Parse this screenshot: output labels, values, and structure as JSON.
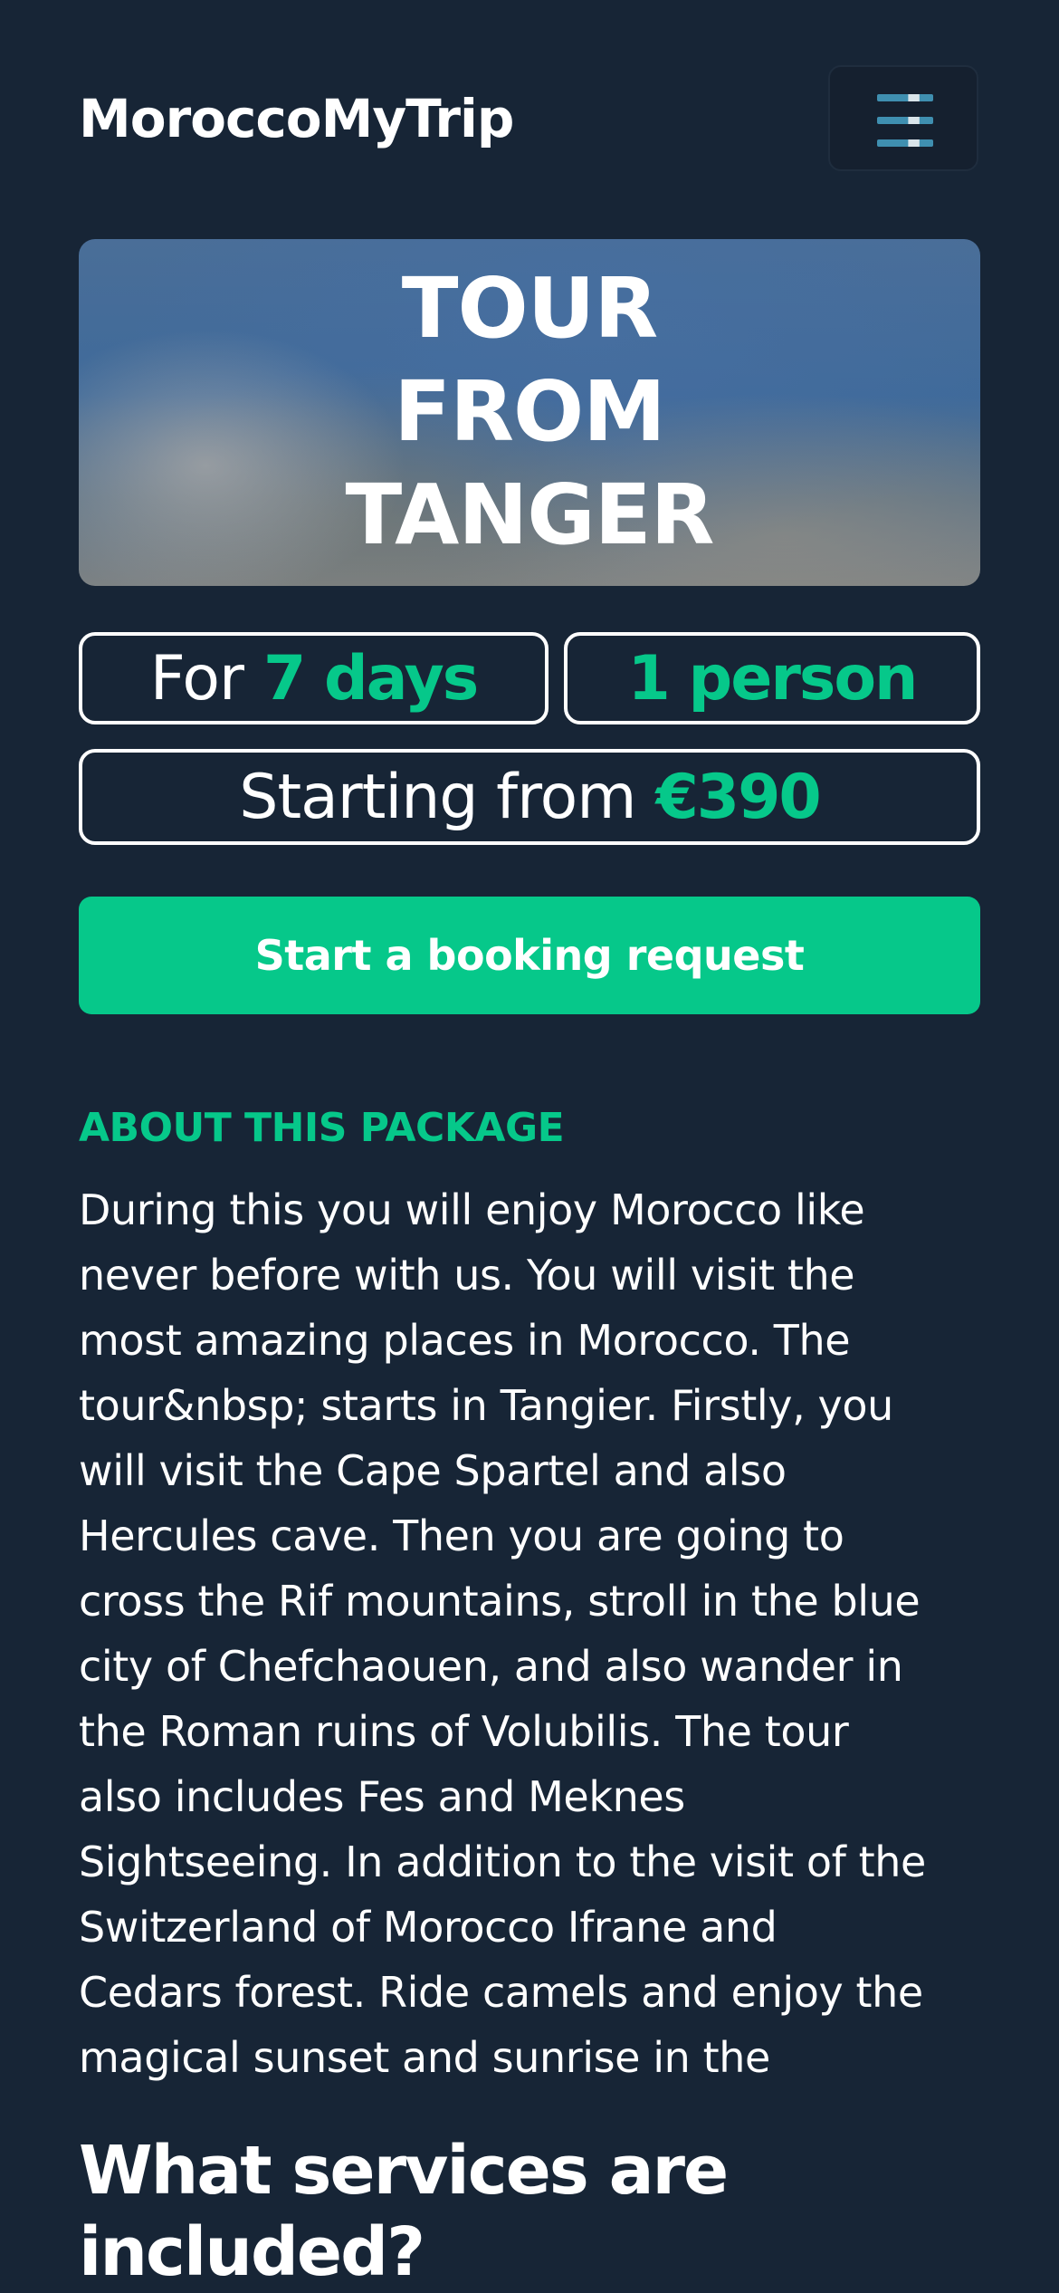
{
  "header": {
    "brand": "MoroccoMyTrip",
    "menu_icon": "hamburger-menu-icon"
  },
  "hero": {
    "title_lines": [
      "TOUR",
      "FROM",
      "TANGER"
    ]
  },
  "details": {
    "duration_prefix": "For",
    "duration_value": "7 days",
    "persons": "1 person",
    "price_prefix": "Starting from",
    "price_value": "€390"
  },
  "cta": {
    "label": "Start a booking request"
  },
  "about": {
    "heading": "ABOUT THIS PACKAGE",
    "lines": [
      "During this you will enjoy Morocco like",
      "never before with us. You will visit the",
      "most amazing places in Morocco. The",
      "tour&nbsp; starts in Tangier. Firstly, you",
      "will visit the Cape Spartel and also",
      "Hercules cave. Then you are going to",
      "cross the Rif mountains, stroll in the blue",
      "city of Chefchaouen, and also wander in",
      "the Roman ruins of Volubilis. The tour",
      "also includes Fes and Meknes",
      "Sightseeing. In addition to the visit of the",
      "Switzerland of Morocco Ifrane and",
      "Cedars forest. Ride camels and enjoy the",
      "magical sunset and sunrise in the"
    ]
  },
  "services": {
    "heading_lines": [
      "What services are",
      "included?"
    ]
  },
  "colors": {
    "background": "#172536",
    "accent": "#06c88a",
    "text": "#ffffff"
  }
}
